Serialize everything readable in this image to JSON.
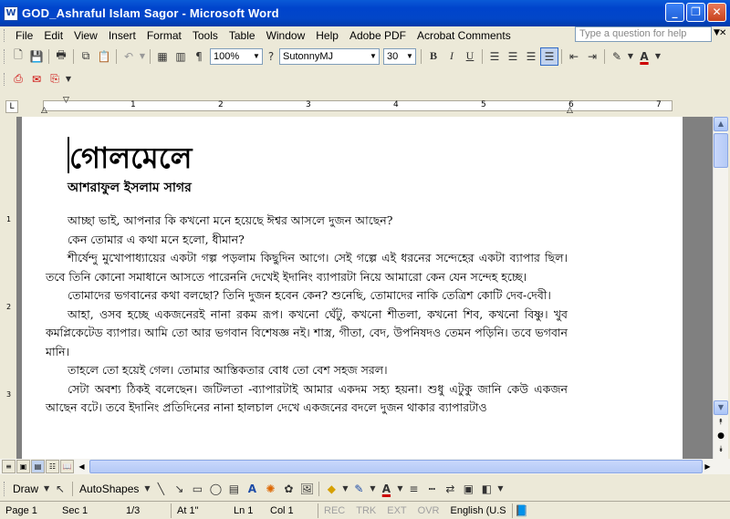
{
  "window": {
    "title": "GOD_Ashraful Islam Sagor - Microsoft Word",
    "minimize": "_",
    "restore": "❐",
    "close": "✕"
  },
  "menu": {
    "items": [
      {
        "label": "File"
      },
      {
        "label": "Edit"
      },
      {
        "label": "View"
      },
      {
        "label": "Insert"
      },
      {
        "label": "Format"
      },
      {
        "label": "Tools"
      },
      {
        "label": "Table"
      },
      {
        "label": "Window"
      },
      {
        "label": "Help"
      },
      {
        "label": "Adobe PDF"
      },
      {
        "label": "Acrobat Comments"
      }
    ],
    "help_placeholder": "Type a question for help"
  },
  "toolbar": {
    "zoom": "100%",
    "font": "SutonnyMJ",
    "size": "30",
    "bold": "B",
    "italic": "I",
    "underline": "U"
  },
  "ruler": {
    "numbers": [
      "1",
      "2",
      "3",
      "4",
      "5",
      "6",
      "7"
    ]
  },
  "document": {
    "title": "গোলমেলে",
    "author": "আশরাফুল ইসলাম সাগর",
    "paragraphs": [
      "আচ্ছা ভাই, আপনার কি কখনো মনে হয়েছে ঈশ্বর আসলে দুজন আছেন?",
      "কেন তোমার এ কথা মনে হলো, ধীমান?",
      "শীর্ষেন্দু মুখোপাধ্যায়ের একটা গল্প পড়লাম কিছুদিন আগে। সেই গল্পে এই ধরনের সন্দেহের একটা ব্যাপার ছিল। তবে তিনি কোনো সমাধানে আসতে পারেননি দেখেই ইদানিং ব্যাপারটা নিয়ে আমারো কেন যেন সন্দেহ হচ্ছে।",
      "তোমাদের ভগবানের কথা বলছো? তিনি দুজন হবেন কেন? শুনেছি, তোমাদের নাকি তেত্রিশ কোটি দেব-দেবী।",
      "আহা, ওসব হচ্ছে একজনেরই নানা রকম রূপ। কখনো ঘেঁটু, কখনো শীতলা, কখনো শিব, কখনো বিষ্ণু। খুব কমপ্লিকেটেড ব্যাপার। আমি তো আর ভগবান বিশেষজ্ঞ নই। শাস্ত্র, গীতা, বেদ, উপনিষদও তেমন পড়িনি। তবে ভগবান মানি।",
      "তাহলে তো হয়েই গেল। তোমার আস্তিকতার বোধ তো বেশ সহজ সরল।",
      "সেটা অবশ্য ঠিকই বলেছেন। জটিলতা -ব্যাপারটাই আমার একদম সহ্য হয়না। শুধু এটুকু জানি কেউ একজন আছেন বটে। তবে ইদানিং প্রতিদিনের নানা হালচাল দেখে একজনের বদলে দুজন থাকার ব্যাপারটাও"
    ]
  },
  "drawbar": {
    "draw": "Draw",
    "autoshapes": "AutoShapes"
  },
  "status": {
    "page": "Page 1",
    "sec": "Sec 1",
    "pages": "1/3",
    "at": "At 1\"",
    "ln": "Ln 1",
    "col": "Col 1",
    "rec": "REC",
    "trk": "TRK",
    "ext": "EXT",
    "ovr": "OVR",
    "lang": "English (U.S"
  }
}
